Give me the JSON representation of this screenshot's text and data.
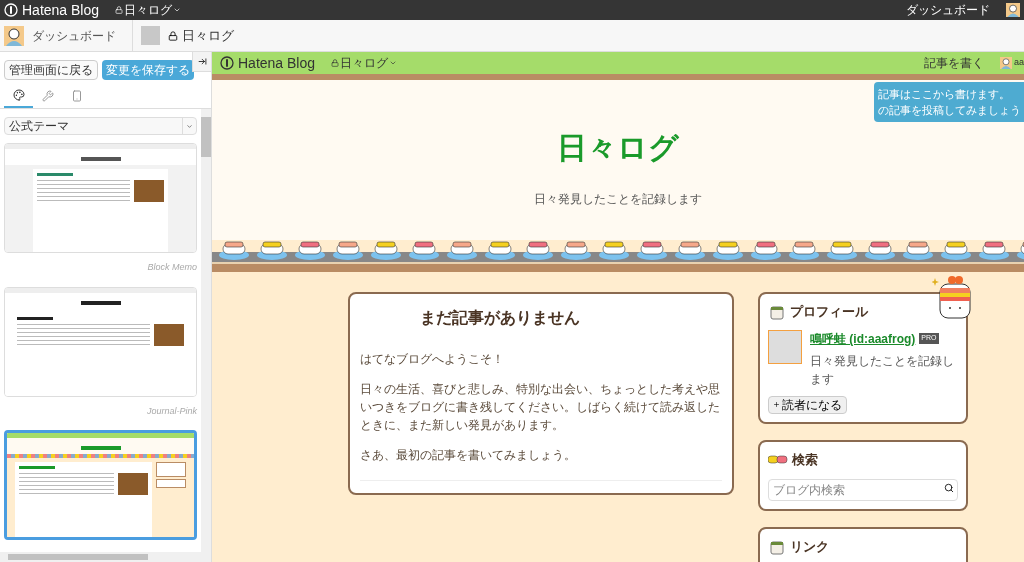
{
  "top_bar": {
    "logo": "Hatena Blog",
    "blog": "日々ログ",
    "dashboard": "ダッシュボード"
  },
  "sub_bar": {
    "dashboard": "ダッシュボード",
    "blog": "日々ログ"
  },
  "editor": {
    "back_button": "管理画面に戻る",
    "save_button": "変更を保存する",
    "tabs": [
      {
        "kind": "design",
        "selected": true
      },
      {
        "kind": "settings",
        "selected": false
      },
      {
        "kind": "mobile",
        "selected": false
      }
    ],
    "theme_select": "公式テーマ",
    "themes": [
      {
        "kind": "memo",
        "name": "Block Memo",
        "selected": false
      },
      {
        "kind": "journal",
        "name": "Journal-Pink",
        "selected": false
      },
      {
        "kind": "sushi",
        "selected": true
      }
    ]
  },
  "preview": {
    "nav": {
      "logo": "Hatena Blog",
      "blog": "日々ログ",
      "write": "記事を書く",
      "user": "aa"
    },
    "tooltip": [
      "記事はここから書けます。",
      "の記事を投稿してみましょう"
    ],
    "title": "日々ログ",
    "description": "日々発見したことを記録します",
    "post": {
      "title": "まだ記事がありません",
      "paragraphs": [
        "はてなブログへようこそ！",
        "日々の生活、喜びと悲しみ、特別な出会い、ちょっとした考えや思いつきをブログに書き残してください。しばらく続けて読み返したときに、また新しい発見があります。",
        "さあ、最初の記事を書いてみましょう。"
      ]
    },
    "profile": {
      "heading": "プロフィール",
      "name": "鳴呼蛙 (id:aaafrog)",
      "badge": "PRO",
      "bio": "日々発見したことを記録します",
      "follow": "読者になる"
    },
    "search": {
      "heading": "検索",
      "placeholder": "ブログ内検索"
    },
    "links": {
      "heading": "リンク"
    }
  }
}
